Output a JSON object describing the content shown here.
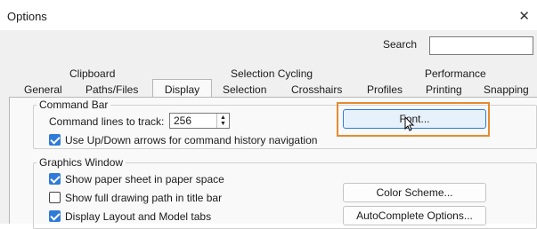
{
  "window": {
    "title": "Options"
  },
  "search": {
    "label": "Search",
    "value": ""
  },
  "tabs": {
    "row1": [
      "Clipboard",
      "Selection Cycling",
      "Performance"
    ],
    "row2": [
      "General",
      "Paths/Files",
      "Display",
      "Selection",
      "Crosshairs",
      "Profiles",
      "Printing",
      "Snapping"
    ],
    "active": "Display"
  },
  "command_bar": {
    "title": "Command Bar",
    "lines_label": "Command lines to track:",
    "lines_value": "256",
    "use_arrows": {
      "label": "Use Up/Down arrows for command history navigation",
      "checked": true
    },
    "font_button": "Font..."
  },
  "graphics_window": {
    "title": "Graphics Window",
    "options": [
      {
        "label": "Show paper sheet in paper space",
        "checked": true
      },
      {
        "label": "Show full drawing path in title bar",
        "checked": false
      },
      {
        "label": "Display Layout and Model tabs",
        "checked": true
      }
    ],
    "color_scheme_button": "Color Scheme...",
    "autocomplete_button": "AutoComplete Options..."
  },
  "colors": {
    "accent": "#2f7bd9",
    "highlight": "#e58b2f"
  }
}
